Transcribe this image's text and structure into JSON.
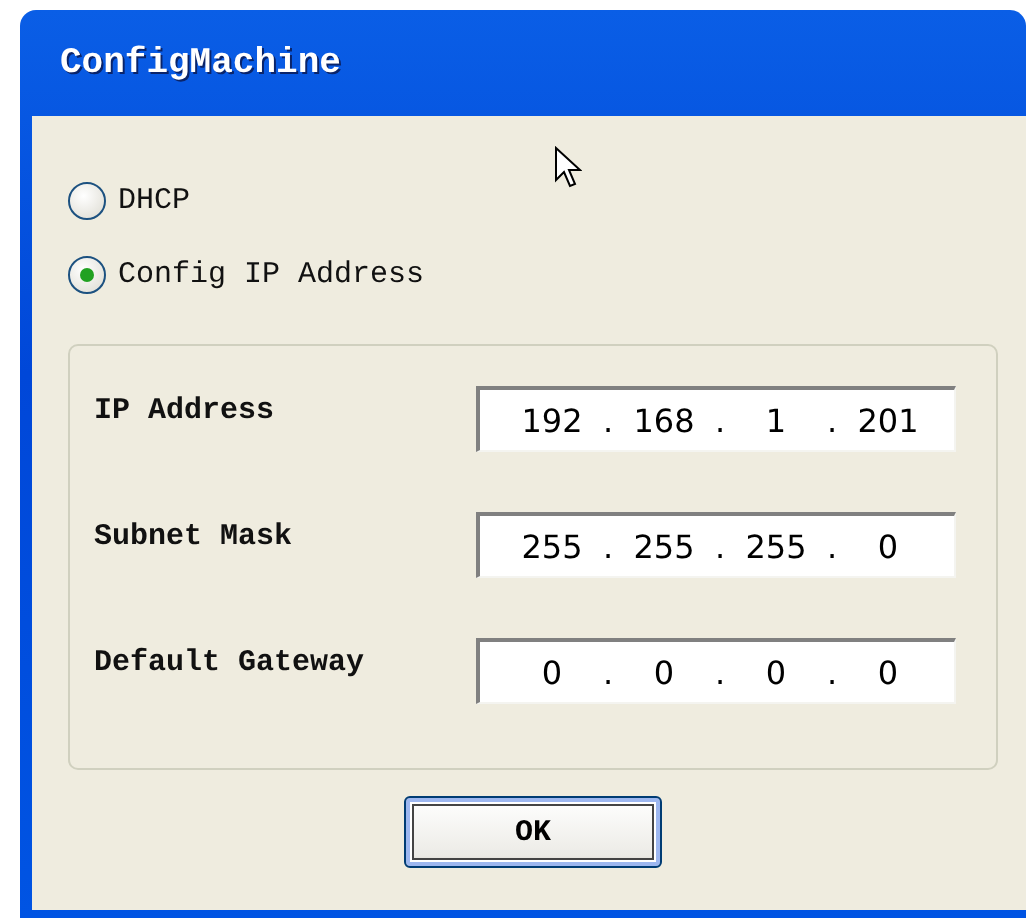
{
  "window": {
    "title": "ConfigMachine"
  },
  "mode_options": [
    {
      "label": "DHCP",
      "selected": false
    },
    {
      "label": "Config IP Address",
      "selected": true
    }
  ],
  "fields": [
    {
      "label": "IP Address",
      "octets": [
        "192",
        "168",
        "1",
        "201"
      ],
      "separator": "."
    },
    {
      "label": "Subnet Mask",
      "octets": [
        "255",
        "255",
        "255",
        "0"
      ],
      "separator": "."
    },
    {
      "label": "Default Gateway",
      "octets": [
        "0",
        "0",
        "0",
        "0"
      ],
      "separator": "."
    }
  ],
  "buttons": [
    {
      "label": "OK",
      "focused": true
    }
  ]
}
